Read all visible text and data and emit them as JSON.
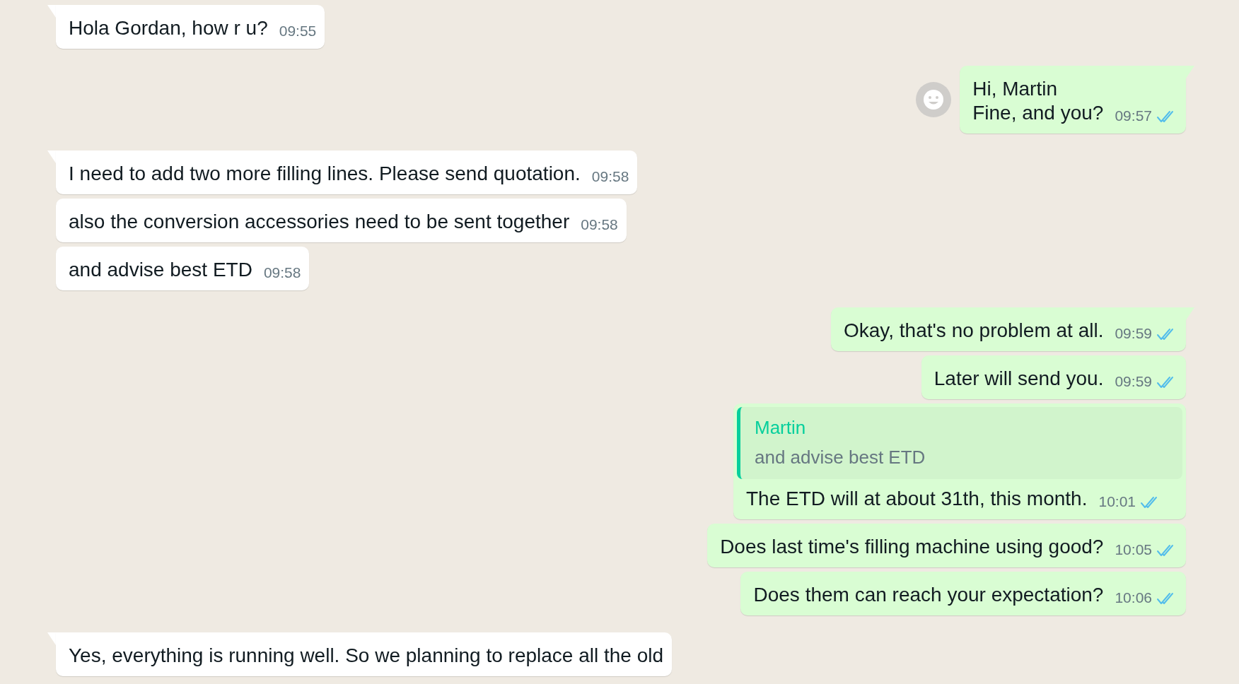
{
  "messages": [
    {
      "kind": "incoming",
      "tail": true,
      "text": "Hola Gordan, how r u?",
      "time": "09:55"
    },
    {
      "kind": "outgoing",
      "tail": true,
      "avatar": true,
      "text": "Hi, Martin\nFine, and you?",
      "time": "09:57",
      "read": true
    },
    {
      "kind": "incoming",
      "tail": true,
      "text": "I need to add two more filling lines. Please send quotation.",
      "time": "09:58"
    },
    {
      "kind": "incoming",
      "tail": false,
      "text": "also the conversion accessories need to be sent together",
      "time": "09:58"
    },
    {
      "kind": "incoming",
      "tail": false,
      "text": "and advise best ETD",
      "time": "09:58"
    },
    {
      "kind": "outgoing",
      "tail": true,
      "text": "Okay, that's no problem at all.",
      "time": "09:59",
      "read": true
    },
    {
      "kind": "outgoing",
      "tail": false,
      "text": "Later will send you.",
      "time": "09:59",
      "read": true
    },
    {
      "kind": "outgoing",
      "tail": false,
      "quote": {
        "author": "Martin",
        "text": "and advise best ETD"
      },
      "text": "The ETD will at about 31th, this month.",
      "time": "10:01",
      "read": true
    },
    {
      "kind": "outgoing",
      "tail": false,
      "text": "Does last time's filling machine using good?",
      "time": "10:05",
      "read": true
    },
    {
      "kind": "outgoing",
      "tail": false,
      "text": "Does them can reach your expectation?",
      "time": "10:06",
      "read": true
    },
    {
      "kind": "incoming",
      "tail": true,
      "text": "Yes, everything is running well. So we planning to replace all the old"
    }
  ]
}
